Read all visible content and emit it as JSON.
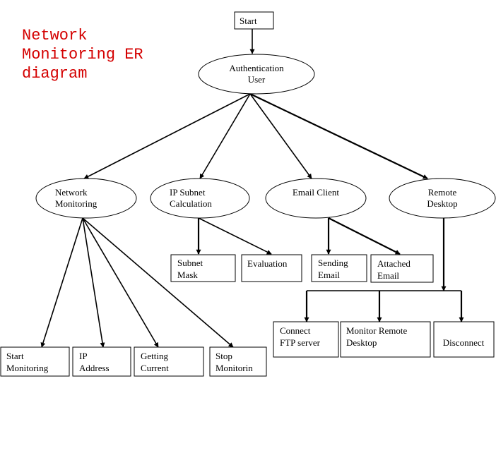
{
  "title": {
    "lines": [
      "Network",
      "Monitoring ER",
      "diagram"
    ],
    "color": "#d40000"
  },
  "nodes": {
    "start": {
      "shape": "rect",
      "lines": [
        "Start"
      ]
    },
    "auth_user": {
      "shape": "ellipse",
      "lines": [
        "Authentication",
        "User"
      ]
    },
    "network_monitoring": {
      "shape": "ellipse",
      "lines": [
        "Network",
        "Monitoring"
      ]
    },
    "ip_subnet_calculation": {
      "shape": "ellipse",
      "lines": [
        "IP Subnet",
        "Calculation"
      ]
    },
    "email_client": {
      "shape": "ellipse",
      "lines": [
        "Email Client"
      ]
    },
    "remote_desktop": {
      "shape": "ellipse",
      "lines": [
        "Remote",
        "Desktop"
      ]
    },
    "subnet_mask": {
      "shape": "rect",
      "lines": [
        "Subnet",
        "Mask"
      ]
    },
    "evaluation": {
      "shape": "rect",
      "lines": [
        "Evaluation"
      ]
    },
    "sending_email": {
      "shape": "rect",
      "lines": [
        "Sending",
        "Email"
      ]
    },
    "attached_email": {
      "shape": "rect",
      "lines": [
        "Attached",
        "Email"
      ]
    },
    "start_monitoring": {
      "shape": "rect",
      "lines": [
        "Start",
        "Monitoring"
      ]
    },
    "ip_address": {
      "shape": "rect",
      "lines": [
        "IP",
        "Address"
      ]
    },
    "getting_current": {
      "shape": "rect",
      "lines": [
        "Getting",
        "Current"
      ]
    },
    "stop_monitoring": {
      "shape": "rect",
      "lines": [
        "Stop",
        "Monitorin"
      ]
    },
    "connect_ftp_server": {
      "shape": "rect",
      "lines": [
        "Connect",
        "FTP server"
      ]
    },
    "monitor_remote_desktop": {
      "shape": "rect",
      "lines": [
        "Monitor Remote",
        "Desktop"
      ]
    },
    "disconnect": {
      "shape": "rect",
      "lines": [
        "Disconnect"
      ]
    }
  },
  "edges": [
    {
      "from": "start",
      "to": "auth_user"
    },
    {
      "from": "auth_user",
      "to": "network_monitoring"
    },
    {
      "from": "auth_user",
      "to": "ip_subnet_calculation"
    },
    {
      "from": "auth_user",
      "to": "email_client"
    },
    {
      "from": "auth_user",
      "to": "remote_desktop"
    },
    {
      "from": "ip_subnet_calculation",
      "to": "subnet_mask"
    },
    {
      "from": "ip_subnet_calculation",
      "to": "evaluation"
    },
    {
      "from": "email_client",
      "to": "sending_email"
    },
    {
      "from": "email_client",
      "to": "attached_email"
    },
    {
      "from": "network_monitoring",
      "to": "start_monitoring"
    },
    {
      "from": "network_monitoring",
      "to": "ip_address"
    },
    {
      "from": "network_monitoring",
      "to": "getting_current"
    },
    {
      "from": "network_monitoring",
      "to": "stop_monitoring"
    },
    {
      "from": "remote_desktop",
      "to": "connect_ftp_server"
    },
    {
      "from": "remote_desktop",
      "to": "monitor_remote_desktop"
    },
    {
      "from": "remote_desktop",
      "to": "disconnect"
    }
  ]
}
